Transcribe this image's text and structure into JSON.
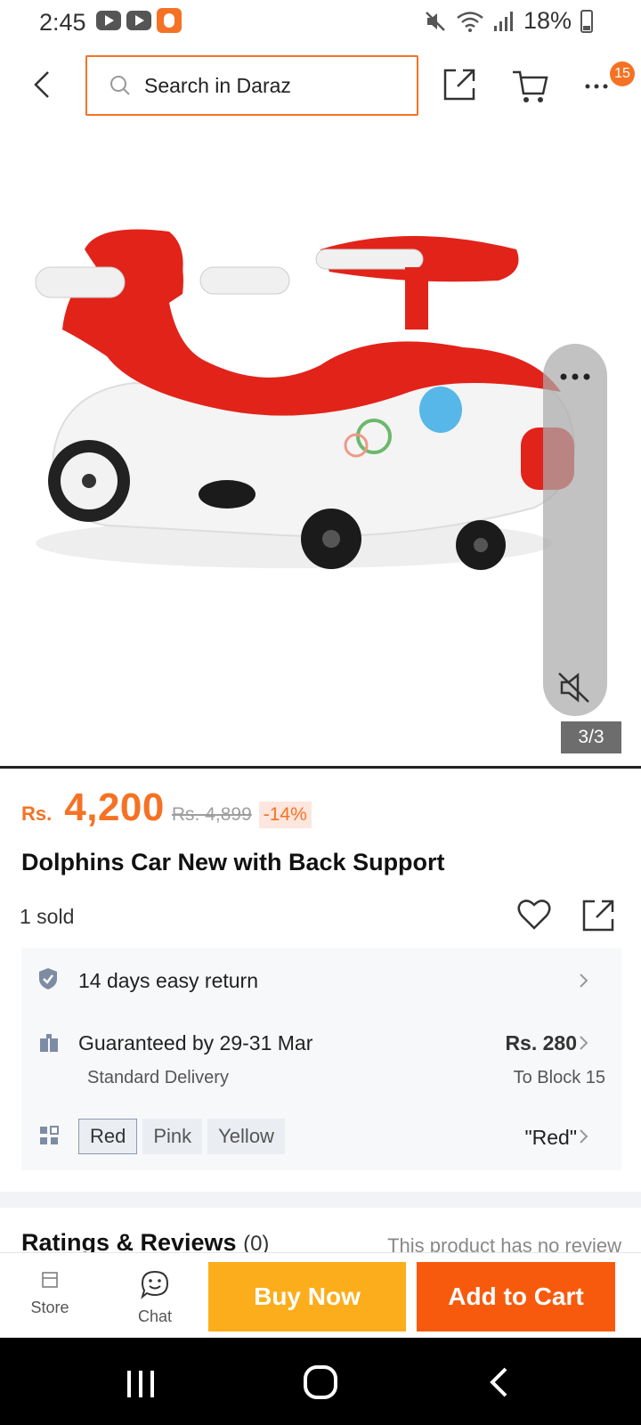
{
  "status_bar": {
    "time": "2:45",
    "battery": "18%",
    "icons": [
      "youtube-icon",
      "youtube-icon",
      "daraz-app-icon",
      "mute-icon",
      "wifi-icon",
      "signal-icon",
      "battery-icon"
    ]
  },
  "header": {
    "search_placeholder": "Search in Daraz",
    "cart_badge": "15",
    "icons": [
      "back-arrow-icon",
      "search-icon",
      "share-icon",
      "cart-icon",
      "more-icon"
    ]
  },
  "gallery": {
    "counter": "3/3",
    "image_subject": "red-white kids ride-on car",
    "icons": [
      "more-dots-icon",
      "speaker-mute-icon"
    ]
  },
  "product": {
    "currency": "Rs.",
    "price": "4,200",
    "original_price": "Rs. 4,899",
    "discount": "-14%",
    "title": "Dolphins Car New with Back Support",
    "sold": "1 sold"
  },
  "info": {
    "return_policy": "14 days easy return",
    "delivery_title": "Guaranteed by 29-31 Mar",
    "delivery_type": "Standard Delivery",
    "delivery_fee": "Rs. 280",
    "delivery_location": "To Block 15",
    "variants": [
      "Red",
      "Pink",
      "Yellow"
    ],
    "selected_variant": "\"Red\""
  },
  "reviews": {
    "heading": "Ratings & Reviews",
    "count": "(0)",
    "empty_text": "This product has no review"
  },
  "actions": {
    "store": "Store",
    "chat": "Chat",
    "buy_now": "Buy Now",
    "add_to_cart": "Add to Cart"
  },
  "colors": {
    "brand_orange": "#f57224",
    "buy_now_yellow": "#fcad1b",
    "add_to_cart_orange": "#f75a0d"
  }
}
